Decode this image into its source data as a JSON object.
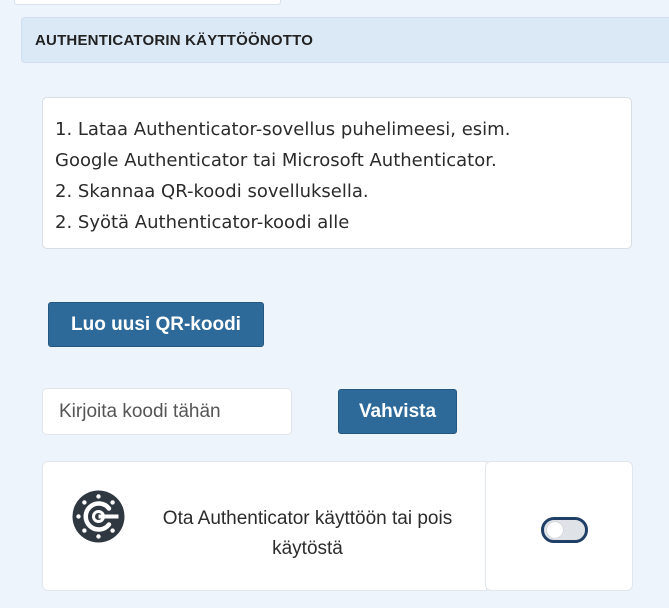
{
  "panel": {
    "title": "AUTHENTICATORIN KÄYTTÖÖNOTTO"
  },
  "instructions": {
    "lines": [
      "1. Lataa Authenticator-sovellus puhelimeesi, esim.",
      "Google Authenticator tai Microsoft Authenticator.",
      "2. Skannaa QR-koodi sovelluksella.",
      "2. Syötä Authenticator-koodi alle"
    ]
  },
  "qr_button": {
    "label": "Luo uusi QR-koodi"
  },
  "code_input": {
    "placeholder": "Kirjoita koodi tähän",
    "value": ""
  },
  "verify_button": {
    "label": "Vahvista"
  },
  "toggle": {
    "label": "Ota Authenticator käyttöön tai pois käytöstä",
    "icon": "authenticator-icon",
    "state": "off"
  },
  "colors": {
    "button": "#2e6a99",
    "header_bg": "#dbe9f6",
    "page_bg": "#eef4fb",
    "switch_border": "#1f3f66"
  }
}
